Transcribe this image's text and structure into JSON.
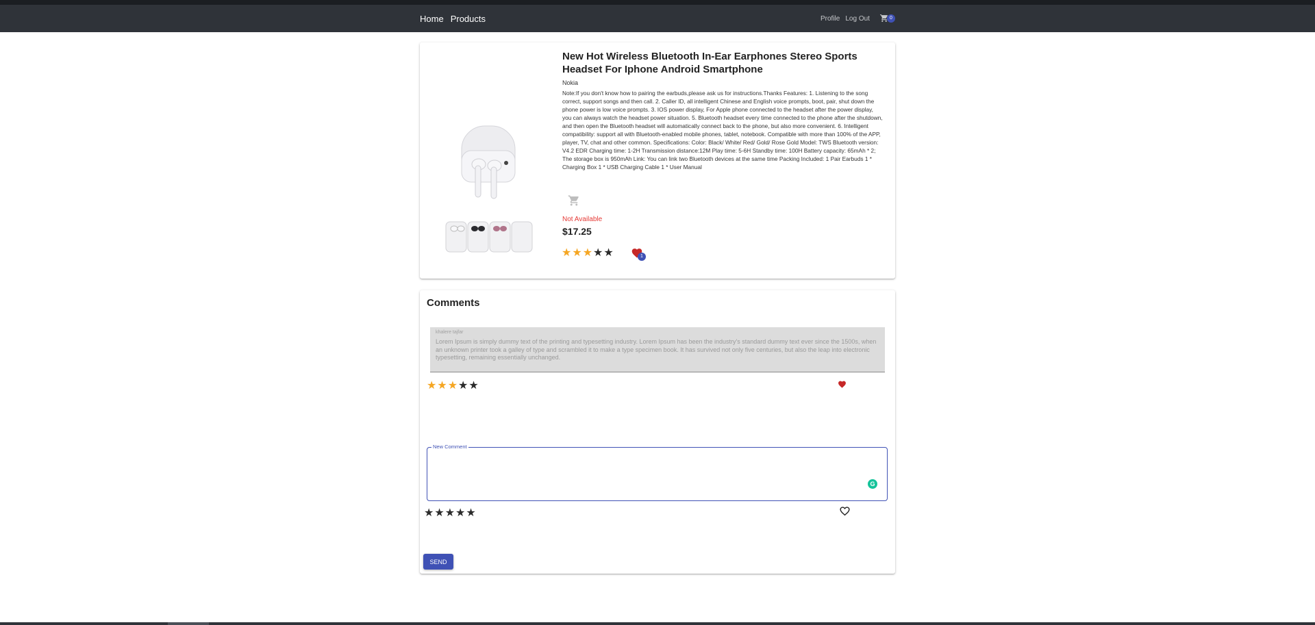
{
  "nav": {
    "home": "Home",
    "products": "Products",
    "profile": "Profile",
    "logout": "Log Out",
    "cart_count": "0"
  },
  "product": {
    "title": "New Hot Wireless Bluetooth In-Ear Earphones Stereo Sports Headset For Iphone Android Smartphone",
    "brand": "Nokia",
    "description": "Note:If you don't know how to pairing the earbuds,please ask us for instructions.Thanks Features: 1. Listening to the song correct, support songs and then call. 2. Caller ID, all intelligent Chinese and English voice prompts, boot, pair, shut down the phone power is low voice prompts. 3. IOS power display, For Apple phone connected to the headset after the power display, you can always watch the headset power situation. 5. Bluetooth headset every time connected to the phone after the shutdown, and then open the Bluetooth headset will automatically connect back to the phone, but also more convenient. 6. Intelligent compatibility: support all with Bluetooth-enabled mobile phones, tablet, notebook. Compatible with more than 100% of the APP, player, TV, chat and other common. Specifications: Color: Black/ White/ Red/ Gold/ Rose Gold Model: TWS Bluetooth version: V4.2 EDR Charging time: 1-2H Transmission distance:12M Play time: 5-6H Standby time: 100H Battery capacity: 65mAh * 2; The storage box is 950mAh Link: You can link two Bluetooth devices at the same time Packing Included: 1 Pair Earbuds 1 * Charging Box 1 * USB Charging Cable 1 * User Manual",
    "availability": "Not Available",
    "price": "$17.25",
    "rating": 3,
    "rating_max": 5,
    "favorites_count": "1",
    "cart_icon": "cart-icon",
    "favorite_icon": "heart-icon"
  },
  "comments": {
    "title": "Comments",
    "items": [
      {
        "author": "khalere tajfar",
        "text": "Lorem Ipsum is simply dummy text of the printing and typesetting industry. Lorem Ipsum has been the industry's standard dummy text ever since the 1500s, when an unknown printer took a galley of type and scrambled it to make a type specimen book. It has survived not only five centuries, but also the leap into electronic typesetting, remaining essentially unchanged.",
        "rating": 3,
        "liked": true
      }
    ],
    "new_comment": {
      "label": "New Comment",
      "value": "",
      "rating": 0,
      "liked": false,
      "send_label": "SEND"
    }
  },
  "colors": {
    "accent": "#3f51b5",
    "navbar": "#2f3339",
    "star_on": "#f5a623",
    "not_available": "#e53935",
    "heart": "#c62828"
  }
}
